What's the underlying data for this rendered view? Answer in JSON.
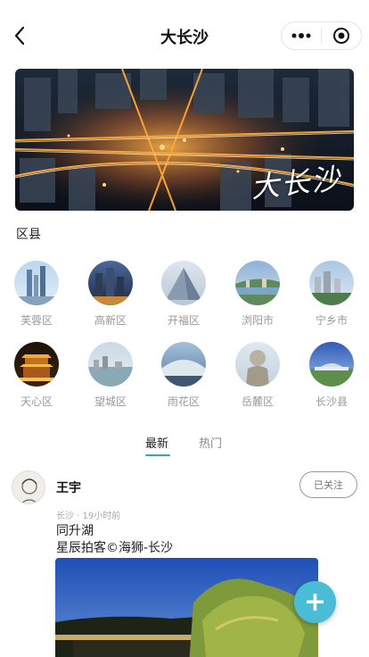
{
  "header": {
    "title": "大长沙"
  },
  "banner": {
    "text": "大长沙"
  },
  "section_label": "区县",
  "districts": [
    {
      "name": "芙蓉区"
    },
    {
      "name": "高新区"
    },
    {
      "name": "开福区"
    },
    {
      "name": "浏阳市"
    },
    {
      "name": "宁乡市"
    },
    {
      "name": "天心区"
    },
    {
      "name": "望城区"
    },
    {
      "name": "雨花区"
    },
    {
      "name": "岳麓区"
    },
    {
      "name": "长沙县"
    }
  ],
  "tabs": [
    {
      "label": "最新",
      "active": true
    },
    {
      "label": "热门",
      "active": false
    }
  ],
  "post": {
    "author": "王宇",
    "follow_label": "已关注",
    "meta": "长沙 · 19小时前",
    "title": "同升湖",
    "caption": "星辰拍客©海狮-长沙"
  },
  "fab": {
    "label": "+"
  },
  "colors": {
    "accent": "#3aa0c9",
    "fab": "#4bbcd6"
  }
}
